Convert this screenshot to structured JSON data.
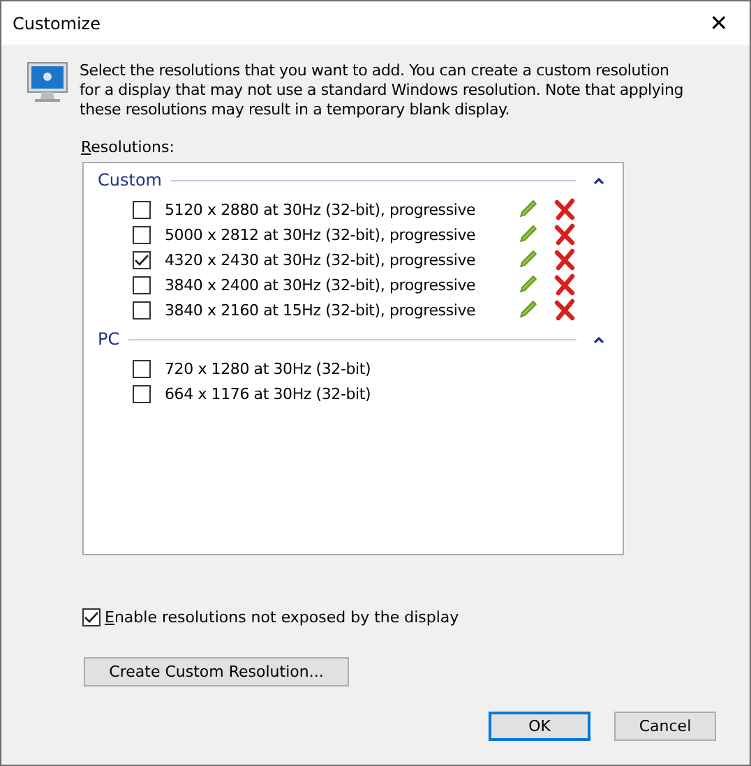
{
  "window": {
    "title": "Customize",
    "close": "✕"
  },
  "description": "Select the resolutions that you want to add. You can create a custom resolution for a display that may not use a standard Windows resolution. Note that applying these resolutions may result in a temporary blank display.",
  "list_label": "Resolutions:",
  "groups": [
    {
      "name": "Custom",
      "expanded": true,
      "editable": true,
      "items": [
        {
          "label": "5120 x 2880 at 30Hz (32-bit), progressive",
          "checked": false
        },
        {
          "label": "5000 x 2812 at 30Hz (32-bit), progressive",
          "checked": false
        },
        {
          "label": "4320 x 2430 at 30Hz (32-bit), progressive",
          "checked": true
        },
        {
          "label": "3840 x 2400 at 30Hz (32-bit), progressive",
          "checked": false
        },
        {
          "label": "3840 x 2160 at 15Hz (32-bit), progressive",
          "checked": false
        }
      ]
    },
    {
      "name": "PC",
      "expanded": true,
      "editable": false,
      "items": [
        {
          "label": "720 x 1280 at 30Hz (32-bit)",
          "checked": false
        },
        {
          "label": "664 x 1176 at 30Hz (32-bit)",
          "checked": false
        }
      ]
    }
  ],
  "enable_option": {
    "label": "Enable resolutions not exposed by the display",
    "checked": true
  },
  "create_button": "Create Custom Resolution...",
  "buttons": [
    {
      "label": "OK",
      "default": true
    },
    {
      "label": "Cancel",
      "default": false
    }
  ]
}
